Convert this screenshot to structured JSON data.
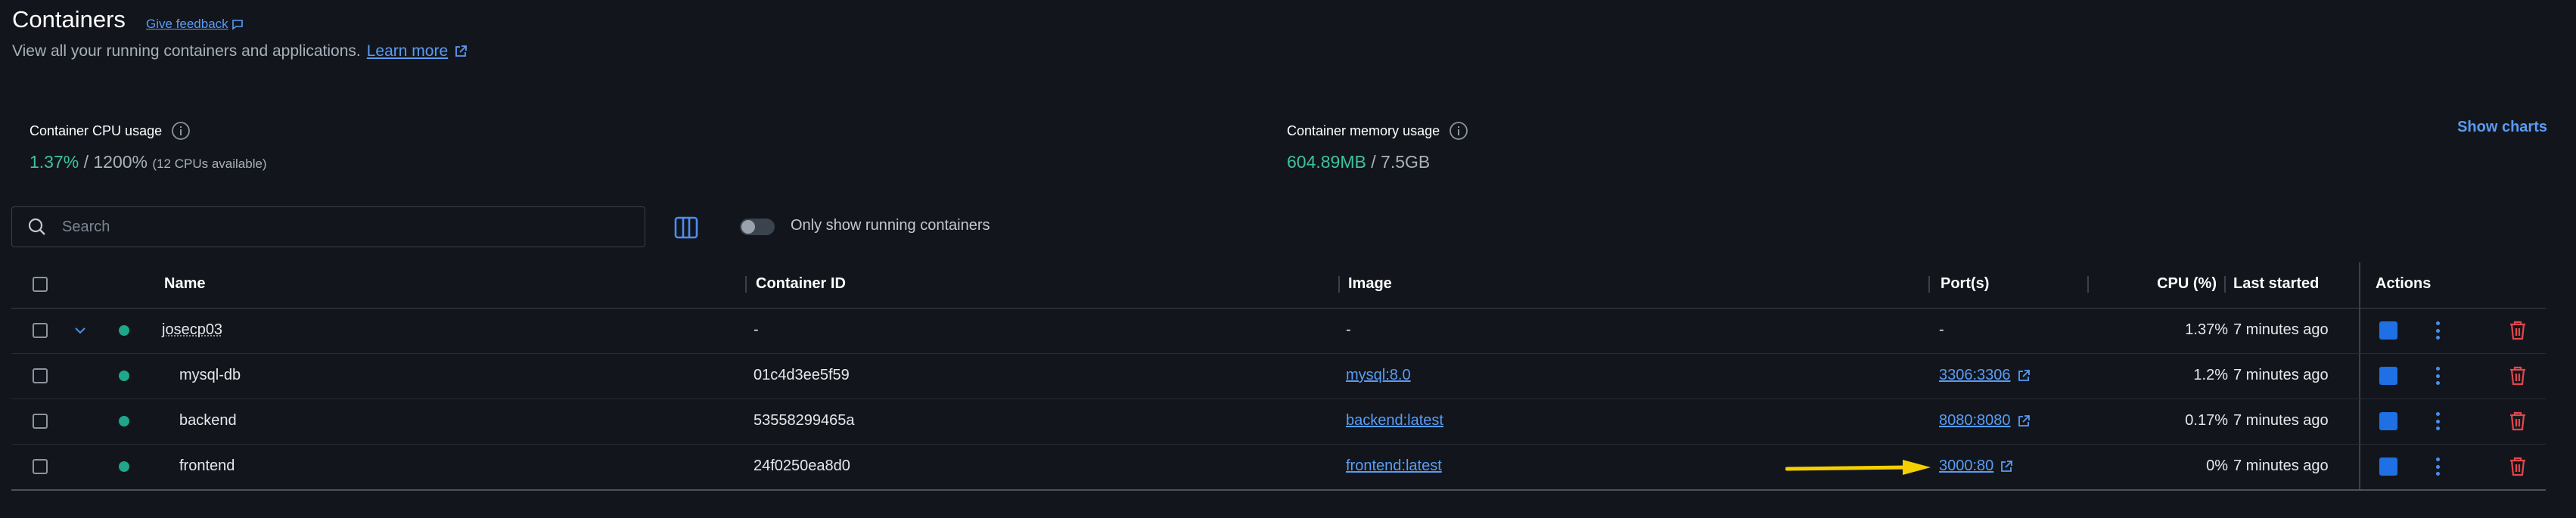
{
  "header": {
    "title": "Containers",
    "feedback_label": "Give feedback",
    "subtitle": "View all your running containers and applications.",
    "learn_more": "Learn more"
  },
  "stats": {
    "cpu": {
      "label": "Container CPU usage",
      "used": "1.37%",
      "total": " / 1200%",
      "note": "(12 CPUs available)"
    },
    "memory": {
      "label": "Container memory usage",
      "used": "604.89MB",
      "total": " / 7.5GB"
    },
    "show_charts": "Show charts"
  },
  "search": {
    "placeholder": "Search",
    "value": ""
  },
  "filter": {
    "toggle_label": "Only show running containers",
    "enabled": false
  },
  "columns": {
    "name": "Name",
    "container_id": "Container ID",
    "image": "Image",
    "ports": "Port(s)",
    "cpu": "CPU (%)",
    "last_started": "Last started",
    "actions": "Actions"
  },
  "rows": [
    {
      "name": "josecp03",
      "id": "-",
      "image": "-",
      "ports": "-",
      "cpu": "1.37%",
      "last_started": "7 minutes ago",
      "status": "running",
      "group": true,
      "expanded": true
    },
    {
      "name": "mysql-db",
      "id": "01c4d3ee5f59",
      "image": "mysql:8.0",
      "ports": "3306:3306",
      "cpu": "1.2%",
      "last_started": "7 minutes ago",
      "status": "running"
    },
    {
      "name": "backend",
      "id": "53558299465a",
      "image": "backend:latest",
      "ports": "8080:8080",
      "cpu": "0.17%",
      "last_started": "7 minutes ago",
      "status": "running"
    },
    {
      "name": "frontend",
      "id": "24f0250ea8d0",
      "image": "frontend:latest",
      "ports": "3000:80",
      "cpu": "0%",
      "last_started": "7 minutes ago",
      "status": "running"
    }
  ],
  "colors": {
    "accent": "#5a9cf5",
    "running": "#1fa68b",
    "stop_button": "#1f6fe5",
    "delete": "#e0474c",
    "annotation_arrow": "#f5d000"
  },
  "annotation": {
    "type": "arrow",
    "points_to": "frontend port 3000:80"
  }
}
